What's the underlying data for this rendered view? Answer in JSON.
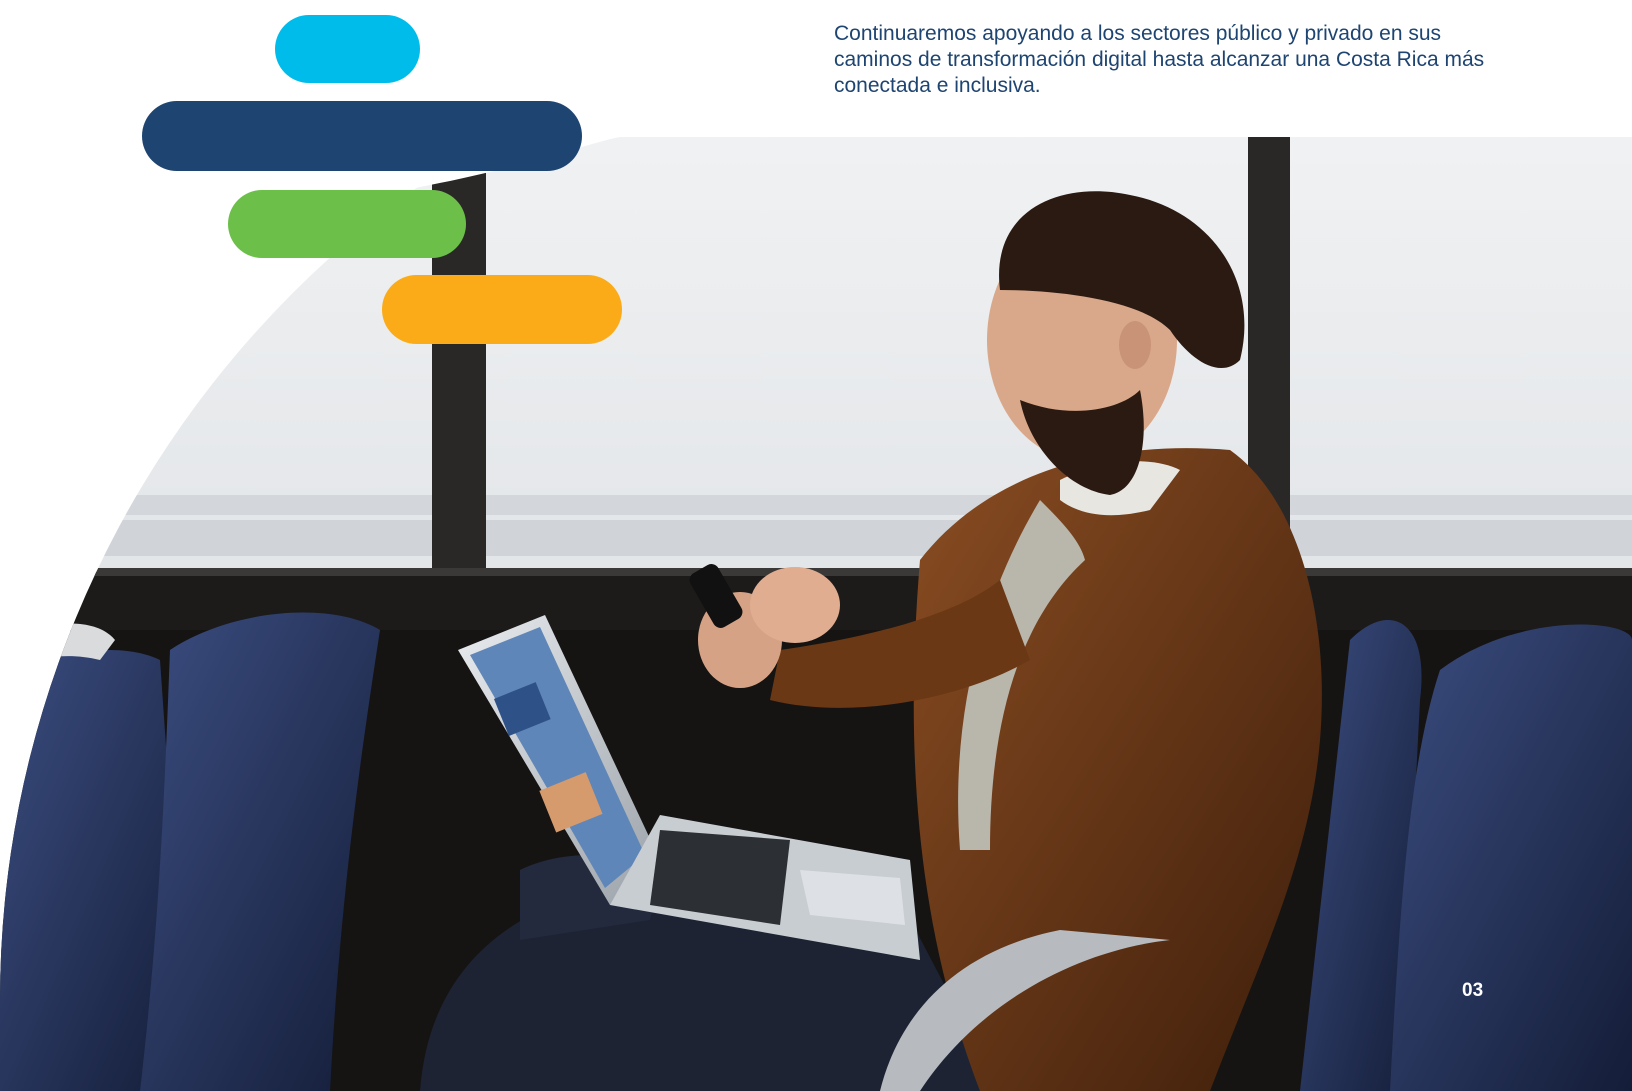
{
  "headline": "Continuaremos apoyando a los sectores público y privado en sus caminos de transformación digital hasta alcanzar una Costa Rica más conectada e inclusiva.",
  "page_number": "03",
  "colors": {
    "cyan": "#00bceb",
    "navy": "#1e4471",
    "green": "#6cc04a",
    "orange": "#fbab18",
    "text": "#1e4471"
  }
}
